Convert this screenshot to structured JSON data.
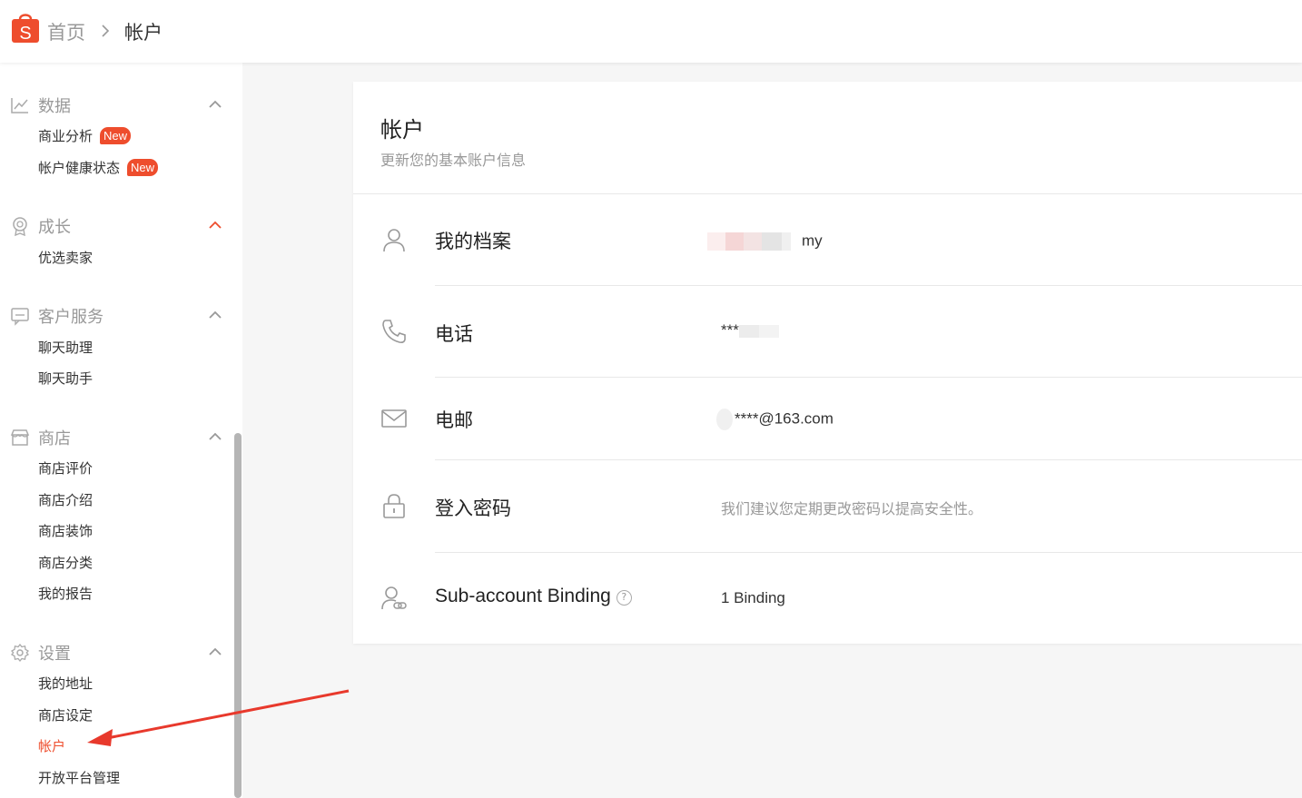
{
  "header": {
    "logo_letter": "S",
    "breadcrumb_home": "首页",
    "breadcrumb_current": "帐户"
  },
  "sidebar": {
    "sections": [
      {
        "title": "数据",
        "icon": "chart-line-icon",
        "items": [
          {
            "label": "商业分析",
            "badge": "New"
          },
          {
            "label": "帐户健康状态",
            "badge": "New"
          }
        ]
      },
      {
        "title": "成长",
        "icon": "award-icon",
        "items": [
          {
            "label": "优选卖家"
          }
        ]
      },
      {
        "title": "客户服务",
        "icon": "chat-bubble-icon",
        "items": [
          {
            "label": "聊天助理"
          },
          {
            "label": "聊天助手"
          }
        ]
      },
      {
        "title": "商店",
        "icon": "store-icon",
        "items": [
          {
            "label": "商店评价"
          },
          {
            "label": "商店介绍"
          },
          {
            "label": "商店装饰"
          },
          {
            "label": "商店分类"
          },
          {
            "label": "我的报告"
          }
        ]
      },
      {
        "title": "设置",
        "icon": "gear-icon",
        "items": [
          {
            "label": "我的地址"
          },
          {
            "label": "商店设定"
          },
          {
            "label": "帐户",
            "active": true
          },
          {
            "label": "开放平台管理"
          }
        ]
      }
    ]
  },
  "account": {
    "title": "帐户",
    "subtitle": "更新您的基本账户信息",
    "rows": [
      {
        "label": "我的档案",
        "icon": "user-icon",
        "value": "my"
      },
      {
        "label": "电话",
        "icon": "phone-icon",
        "value": "***"
      },
      {
        "label": "电邮",
        "icon": "mail-icon",
        "value": "****@163.com"
      },
      {
        "label": "登入密码",
        "icon": "lock-icon",
        "value": "我们建议您定期更改密码以提高安全性。"
      },
      {
        "label": "Sub-account Binding",
        "icon": "user-link-icon",
        "value": "1 Binding",
        "help": "?"
      }
    ]
  },
  "colors": {
    "accent": "#ee4d2d",
    "annotation": "#e8392c"
  }
}
